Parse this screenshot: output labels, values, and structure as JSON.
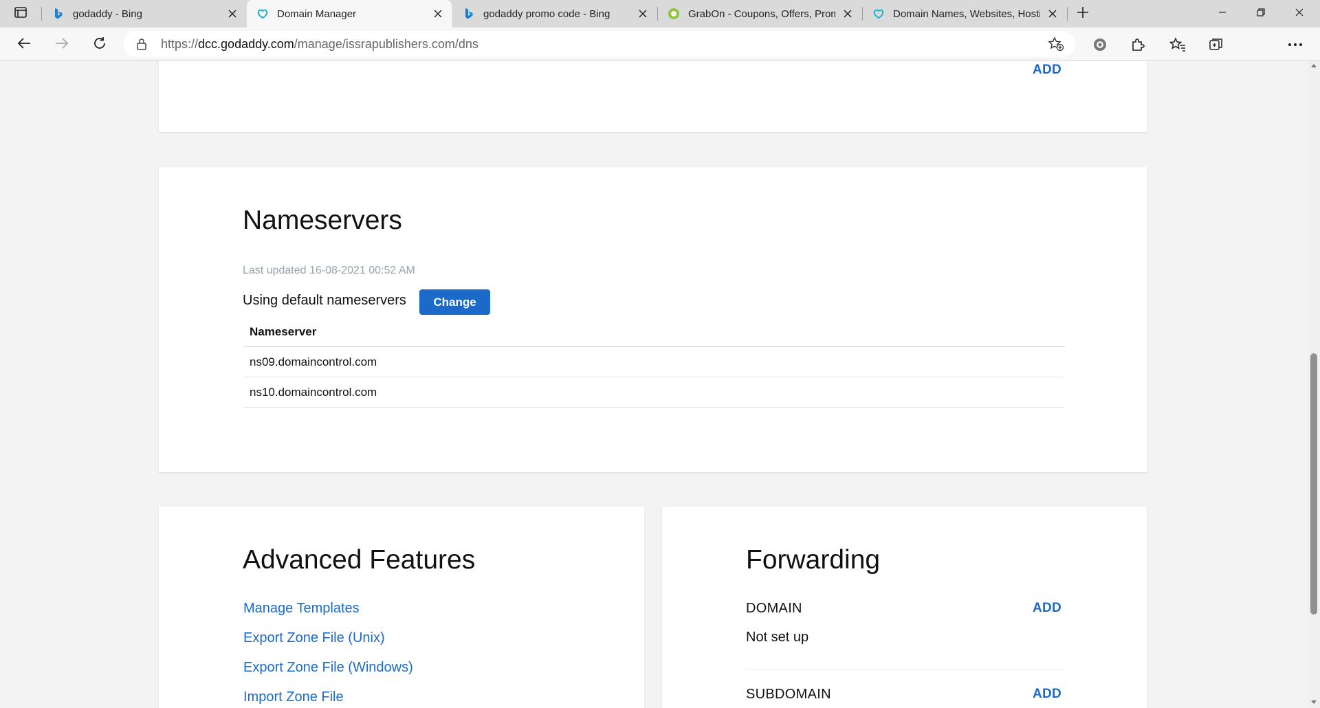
{
  "browser": {
    "tabs": [
      {
        "title": "godaddy - Bing",
        "icon": "bing-icon",
        "active": false
      },
      {
        "title": "Domain Manager",
        "icon": "godaddy-icon",
        "active": true
      },
      {
        "title": "godaddy promo code - Bing",
        "icon": "bing-icon",
        "active": false
      },
      {
        "title": "GrabOn - Coupons, Offers, Promo",
        "icon": "grabon-icon",
        "active": false
      },
      {
        "title": "Domain Names, Websites, Hosting",
        "icon": "godaddy-icon",
        "active": false
      }
    ],
    "url_prefix": "https://",
    "url_host": "dcc.godaddy.com",
    "url_path": "/manage/issrapublishers.com/dns"
  },
  "top_card": {
    "add_label": "ADD"
  },
  "nameservers": {
    "title": "Nameservers",
    "last_updated": "Last updated 16-08-2021 00:52 AM",
    "status_text": "Using default nameservers",
    "change_label": "Change",
    "column_header": "Nameserver",
    "rows": [
      "ns09.domaincontrol.com",
      "ns10.domaincontrol.com"
    ]
  },
  "advanced": {
    "title": "Advanced Features",
    "links": [
      "Manage Templates",
      "Export Zone File (Unix)",
      "Export Zone File (Windows)",
      "Import Zone File"
    ]
  },
  "forwarding": {
    "title": "Forwarding",
    "domain_label": "DOMAIN",
    "domain_add": "ADD",
    "domain_status": "Not set up",
    "subdomain_label": "SUBDOMAIN",
    "subdomain_add": "ADD"
  },
  "colors": {
    "accent": "#1b6ac9",
    "page_bg": "#f3f3f3",
    "muted_text": "#9aa3ad"
  }
}
